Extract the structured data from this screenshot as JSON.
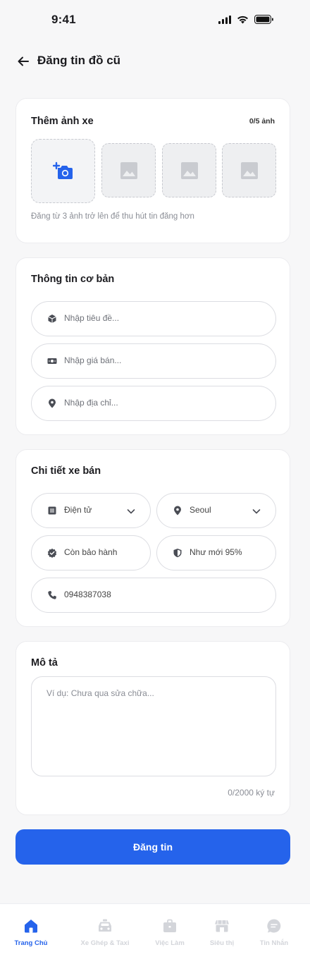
{
  "status_bar": {
    "time": "9:41"
  },
  "header": {
    "title": "Đăng tin đồ cũ",
    "back_icon": "arrow-left-icon"
  },
  "photos": {
    "title": "Thêm ảnh xe",
    "count": "0/5 ảnh",
    "hint": "Đăng từ 3 ảnh trở lên để thu hút tin đăng hơn",
    "accent": "#2563eb"
  },
  "basic_info": {
    "title": "Thông tin cơ bản",
    "fields": [
      {
        "icon": "package-icon",
        "placeholder": "Nhập tiêu đề..."
      },
      {
        "icon": "banknote-icon",
        "placeholder": "Nhập giá bán..."
      },
      {
        "icon": "map-pin-icon",
        "placeholder": "Nhập địa chỉ..."
      }
    ]
  },
  "details": {
    "title": "Chi tiết xe bán",
    "category": {
      "icon": "list-icon",
      "value": "Điện tử"
    },
    "location": {
      "icon": "map-pin-icon",
      "value": "Seoul"
    },
    "warranty": {
      "icon": "badge-check-icon",
      "value": "Còn bảo hành"
    },
    "condition": {
      "icon": "shield-icon",
      "value": "Như mới 95%"
    },
    "phone": {
      "icon": "phone-icon",
      "value": "0948387038"
    }
  },
  "description": {
    "title": "Mô tả",
    "placeholder": "Ví dụ: Chưa qua sửa chữa...",
    "counter": "0/2000 ký tự"
  },
  "submit_label": "Đăng tin",
  "tabs": [
    {
      "label": "Trang Chủ",
      "icon": "home-icon",
      "active": true
    },
    {
      "label": "Xe Ghép & Taxi",
      "icon": "taxi-icon",
      "active": false
    },
    {
      "label": "Việc Làm",
      "icon": "briefcase-icon",
      "active": false
    },
    {
      "label": "Siêu thị",
      "icon": "store-icon",
      "active": false
    },
    {
      "label": "Tin Nhắn",
      "icon": "message-icon",
      "active": false
    }
  ]
}
